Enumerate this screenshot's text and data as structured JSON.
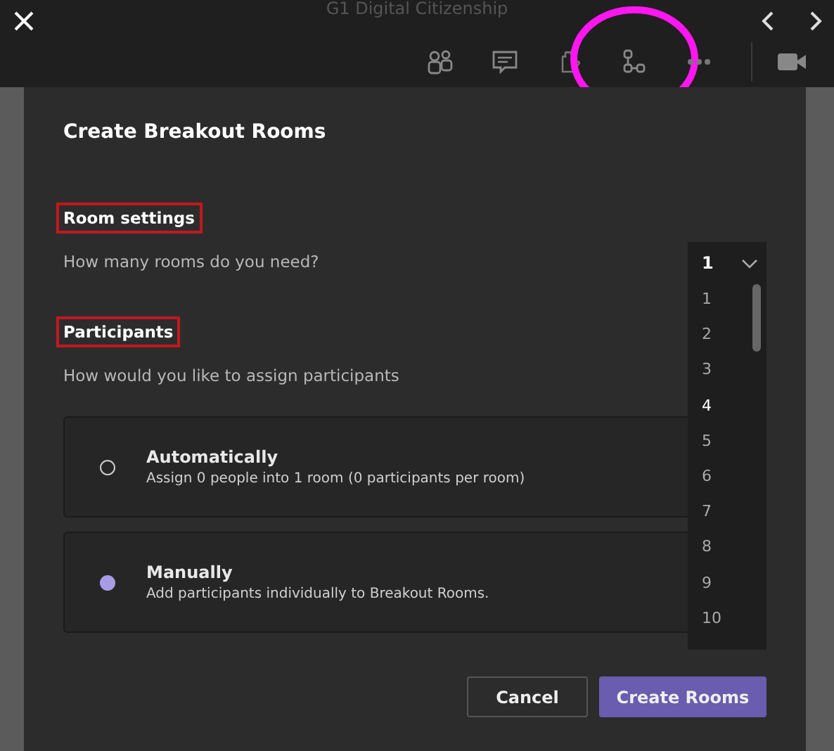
{
  "meeting": {
    "title": "G1 Digital Citizenship",
    "toolbar": [
      {
        "kind": "people"
      },
      {
        "kind": "chat"
      },
      {
        "kind": "hand"
      },
      {
        "kind": "rooms",
        "circled": true
      },
      {
        "kind": "more"
      },
      {
        "kind": "camera"
      }
    ]
  },
  "dialog": {
    "title": "Create Breakout Rooms",
    "sections": [
      {
        "heading": "Room settings",
        "boxed": true,
        "prompt": "How many rooms do you need?"
      },
      {
        "heading": "Participants",
        "boxed": true,
        "prompt": "How would you like to assign participants"
      }
    ],
    "options": [
      {
        "title": "Automatically",
        "description": "Assign 0 people into 1 room (0 participants per room)",
        "selected": false
      },
      {
        "title": "Manually",
        "description": "Add participants individually to Breakout Rooms.",
        "selected": true
      }
    ],
    "room_count": {
      "value": "1",
      "expanded": true,
      "options": [
        {
          "label": "1",
          "hovered": false
        },
        {
          "label": "2",
          "hovered": false
        },
        {
          "label": "3",
          "hovered": false
        },
        {
          "label": "4",
          "hovered": true
        },
        {
          "label": "5",
          "hovered": false
        },
        {
          "label": "6",
          "hovered": false
        },
        {
          "label": "7",
          "hovered": false
        },
        {
          "label": "8",
          "hovered": false
        },
        {
          "label": "9",
          "hovered": false
        },
        {
          "label": "10",
          "hovered": false
        }
      ]
    },
    "buttons": [
      {
        "label": "Cancel",
        "kind": "secondary"
      },
      {
        "label": "Create Rooms",
        "kind": "primary"
      }
    ]
  }
}
